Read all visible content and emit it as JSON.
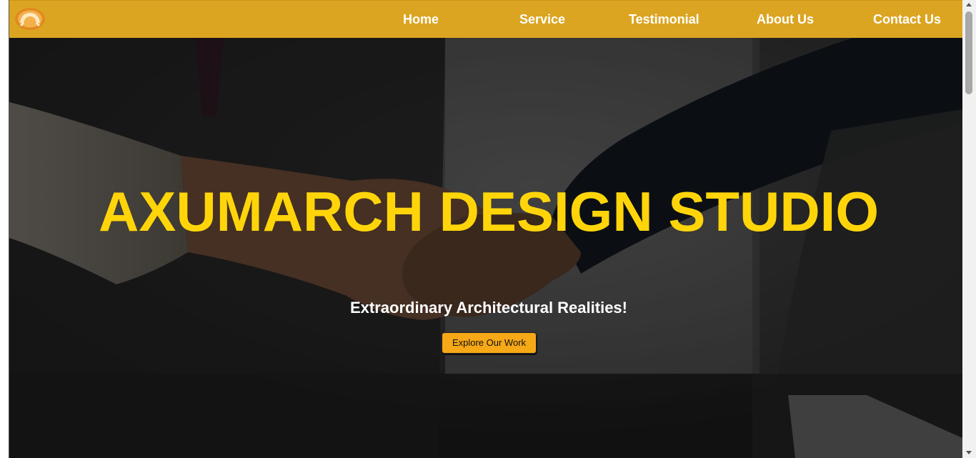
{
  "nav": {
    "logo_icon": "arch-logo-icon",
    "links": [
      "Home",
      "Service",
      "Testimonial",
      "About Us",
      "Contact Us"
    ]
  },
  "hero": {
    "background": "handshake-photo",
    "title": "AXUMARCH DESIGN STUDIO",
    "subtitle": "Extraordinary Architectural Realities!",
    "button_label": "Explore Our Work"
  },
  "colors": {
    "navbar": "#dba521",
    "title": "#ffd50a",
    "button": "#f6a816"
  }
}
